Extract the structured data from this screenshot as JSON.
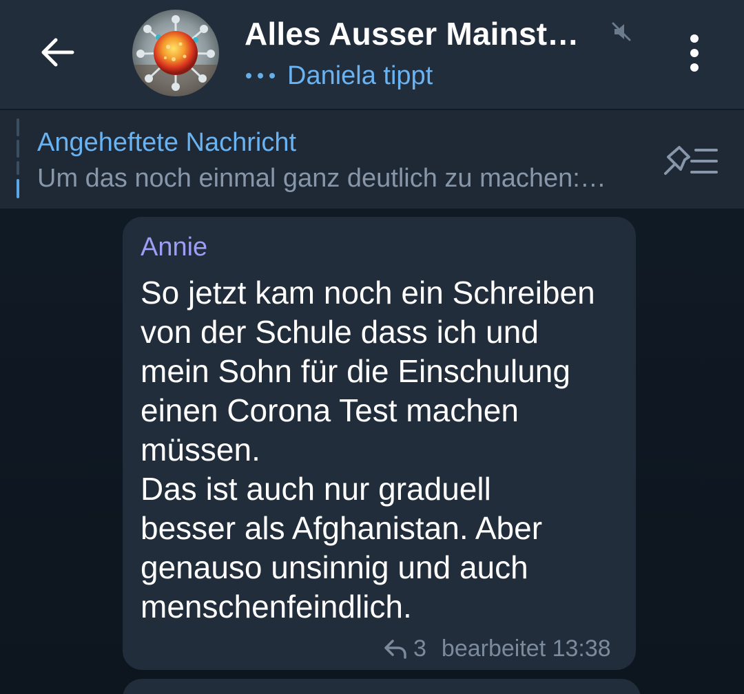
{
  "header": {
    "title": "Alles Ausser Mainst…",
    "status": "Daniela tippt",
    "muted": true,
    "icons": {
      "back": "arrow-left-icon",
      "mute": "muted-speaker-icon",
      "menu": "more-vertical-icon",
      "typing": "typing-dots-icon"
    }
  },
  "pinned": {
    "title": "Angeheftete Nachricht",
    "text": "Um das noch einmal ganz deutlich zu machen:…",
    "icon": "pin-list-icon"
  },
  "message": {
    "sender": "Annie",
    "text": "So jetzt kam noch ein Schreiben\nvon der Schule dass ich und\nmein Sohn für die Einschulung\neinen Corona Test machen\nmüssen.\nDas ist auch nur graduell\nbesser als Afghanistan. Aber\ngenauso unsinnig und auch\nmenschenfeindlich.",
    "reply_count": "3",
    "edited_time": "bearbeitet 13:38",
    "reply_icon": "reply-arrow-icon"
  },
  "colors": {
    "header_bg": "#212d3b",
    "accent": "#6ab3f3",
    "sender": "#9f9ef6",
    "bubble_bg": "#212d3b",
    "chat_bg": "#0e1621"
  }
}
